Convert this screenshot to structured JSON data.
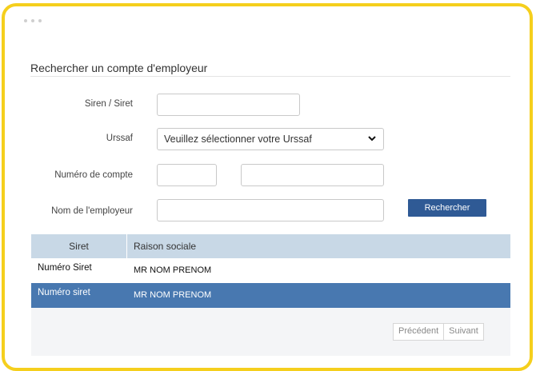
{
  "page": {
    "heading": "Rechercher un compte d'employeur"
  },
  "form": {
    "siren_label": "Siren / Siret",
    "siren_value": "",
    "urssaf_label": "Urssaf",
    "urssaf_selected": "Veuillez sélectionner votre Urssaf",
    "account_label": "Numéro de compte",
    "account_value_1": "",
    "account_value_2": "",
    "employer_label": "Nom de l'employeur",
    "employer_value": "",
    "search_button": "Rechercher"
  },
  "table": {
    "columns": [
      "Siret",
      "Raison sociale"
    ],
    "rows": [
      {
        "siret": "Numéro Siret",
        "raison": "MR  NOM PRENOM"
      },
      {
        "siret": "Numéro siret",
        "raison": "MR  NOM PRENOM"
      }
    ]
  },
  "pager": {
    "previous": "Précédent",
    "next": "Suivant"
  },
  "colors": {
    "frame": "#f5cf1d",
    "button": "#2f5a95",
    "header_row": "#c8d8e6",
    "selected_row": "#4878b0"
  }
}
